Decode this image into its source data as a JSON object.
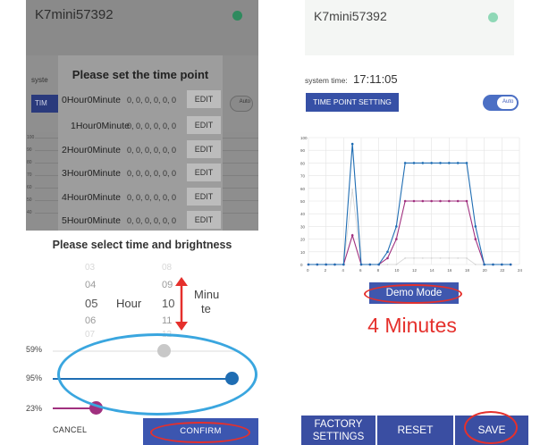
{
  "left_top": {
    "device_name": "K7mini57392",
    "system_label": "syste",
    "time_point_button": "TIM",
    "mode_toggle": "Auto",
    "y_ticks": [
      "100",
      "90",
      "80",
      "70",
      "60",
      "50",
      "40"
    ]
  },
  "time_point_dialog": {
    "title": "Please set the time point",
    "rows": [
      {
        "label": "0Hour0Minute",
        "values": "0, 0, 0, 0, 0, 0",
        "edit": "EDIT"
      },
      {
        "label": "1Hour0Minute",
        "values": "0, 0, 0, 0, 0, 0",
        "edit": "EDIT"
      },
      {
        "label": "2Hour0Minute",
        "values": "0, 0, 0, 0, 0, 0",
        "edit": "EDIT"
      },
      {
        "label": "3Hour0Minute",
        "values": "0, 0, 0, 0, 0, 0",
        "edit": "EDIT"
      },
      {
        "label": "4Hour0Minute",
        "values": "0, 0, 0, 0, 0, 0",
        "edit": "EDIT"
      },
      {
        "label": "5Hour0Minute",
        "values": "0, 0, 0, 0, 0, 0",
        "edit": "EDIT"
      }
    ]
  },
  "brightness_dialog": {
    "title": "Please select time and brightness",
    "hour_faint_above": [
      "03"
    ],
    "hour_mid_above": "04",
    "hour_selected": "05",
    "hour_mid_below": "06",
    "hour_faint_below": [
      "07"
    ],
    "hour_unit": "Hour",
    "minute_faint_above": [
      "08"
    ],
    "minute_mid_above": "09",
    "minute_selected": "10",
    "minute_mid_below": "11",
    "minute_faint_below": [
      "12"
    ],
    "minute_unit_line1": "Minu",
    "minute_unit_line2": "te",
    "sliders": [
      {
        "label": "59%",
        "value": 0.59,
        "color": "#c8c8c8"
      },
      {
        "label": "95%",
        "value": 0.95,
        "color": "#1f6db3"
      },
      {
        "label": "23%",
        "value": 0.23,
        "color": "#a0307f"
      }
    ],
    "cancel_label": "CANCEL",
    "confirm_label": "CONFIRM"
  },
  "right_panel": {
    "device_name": "K7mini57392",
    "system_time_label": "system time:",
    "system_time": "17:11:05",
    "time_point_button": "TIME POINT SETTING",
    "mode_toggle": "Auto",
    "demo_mode_label": "Demo Mode",
    "minutes_caption": "4 Minutes",
    "buttons": {
      "factory_line1": "FACTORY",
      "factory_line2": "SETTINGS",
      "reset": "RESET",
      "save": "SAVE"
    }
  },
  "colors": {
    "accent_blue": "#3650a6",
    "annotation_red": "#e5302c",
    "annotation_blue": "#3aa6df",
    "series_blue": "#1f6db3",
    "series_magenta": "#a0307f",
    "series_gray": "#d4d4d4"
  },
  "chart_data": {
    "type": "line",
    "x": [
      0,
      1,
      2,
      3,
      4,
      5,
      6,
      7,
      8,
      9,
      10,
      11,
      12,
      13,
      14,
      15,
      16,
      17,
      18,
      19,
      20,
      21,
      22,
      23
    ],
    "x_ticks": [
      "0",
      "2",
      "4",
      "6",
      "8",
      "10",
      "12",
      "14",
      "16",
      "18",
      "20",
      "22",
      "24"
    ],
    "y_ticks": [
      "0",
      "10",
      "20",
      "30",
      "40",
      "50",
      "60",
      "70",
      "80",
      "90",
      "100"
    ],
    "xlim": [
      0,
      24
    ],
    "ylim": [
      0,
      100
    ],
    "grid": true,
    "series": [
      {
        "color": "#1f6db3",
        "values": [
          0,
          0,
          0,
          0,
          0,
          95,
          0,
          0,
          0,
          10,
          30,
          80,
          80,
          80,
          80,
          80,
          80,
          80,
          80,
          30,
          0,
          0,
          0,
          0
        ]
      },
      {
        "color": "#a0307f",
        "values": [
          0,
          0,
          0,
          0,
          0,
          23,
          0,
          0,
          0,
          5,
          20,
          50,
          50,
          50,
          50,
          50,
          50,
          50,
          50,
          20,
          0,
          0,
          0,
          0
        ]
      },
      {
        "color": "#d4d4d4",
        "values": [
          0,
          0,
          0,
          0,
          0,
          59,
          0,
          0,
          0,
          0,
          0,
          5,
          5,
          5,
          5,
          5,
          5,
          5,
          5,
          0,
          0,
          0,
          0,
          0
        ]
      }
    ]
  }
}
